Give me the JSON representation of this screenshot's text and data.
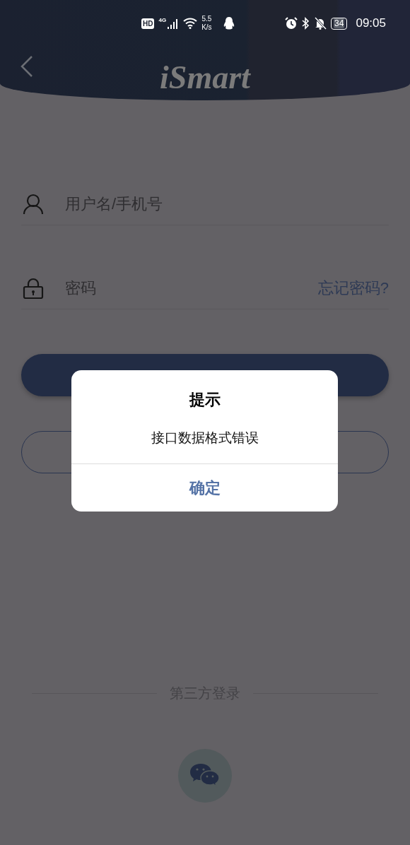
{
  "status_bar": {
    "network_badge": "HD",
    "network_type": "4G",
    "speed_value": "5.5",
    "speed_unit": "K/s",
    "battery": "34",
    "time": "09:05"
  },
  "header": {
    "logo": "iSmart"
  },
  "fields": [
    {
      "kind": "user",
      "placeholder": "用户名/手机号"
    },
    {
      "kind": "password",
      "placeholder": "密码",
      "link": "忘记密码?"
    }
  ],
  "buttons": [
    {
      "kind": "filled"
    },
    {
      "kind": "outline"
    }
  ],
  "third_party": {
    "label": "第三方登录"
  },
  "dialog": {
    "title": "提示",
    "message": "接口数据格式错误",
    "button": "确定"
  }
}
